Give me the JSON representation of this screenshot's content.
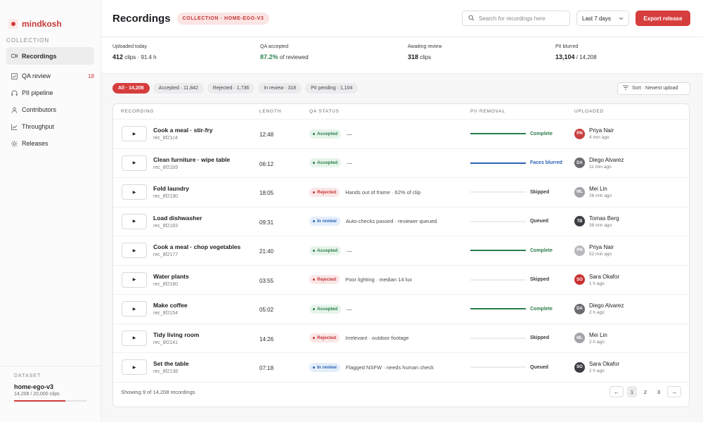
{
  "app": {
    "logo": "mindkosh"
  },
  "sidebar": {
    "section": "COLLECTION",
    "items": [
      {
        "label": "Recordings",
        "icon": "video-icon",
        "active": true,
        "badge": ""
      },
      {
        "label": "QA review",
        "icon": "checkbox-icon",
        "active": false,
        "badge": "18"
      },
      {
        "label": "PII pipeline",
        "icon": "headphones-icon",
        "active": false,
        "badge": ""
      },
      {
        "label": "Contributors",
        "icon": "person-icon",
        "active": false,
        "badge": ""
      },
      {
        "label": "Throughput",
        "icon": "chart-icon",
        "active": false,
        "badge": ""
      },
      {
        "label": "Releases",
        "icon": "sun-icon",
        "active": false,
        "badge": ""
      }
    ],
    "dataset": {
      "label": "DATASET",
      "name": "home-ego-v3",
      "count": "14,208 / 20,000 clips",
      "progress": 0.71,
      "color": "#d03b3b"
    }
  },
  "header": {
    "title": "Recordings",
    "collection": "COLLECTION · HOME-EGO-V3",
    "search_placeholder": "Search for recordings here",
    "range": "Last 7 days",
    "export": "Export release"
  },
  "stats": [
    {
      "label": "Uploaded today",
      "value": "412",
      "suffix": " clips · 91.4 h"
    },
    {
      "label": "QA accepted",
      "value": "87.2%",
      "suffix": " of reviewed"
    },
    {
      "label": "Awaiting review",
      "value": "318",
      "suffix": " clips"
    },
    {
      "label": "PII blurred",
      "value": "13,104",
      "suffix": " / 14,208"
    }
  ],
  "filters": [
    "All · 14,208",
    "Accepted · 11,842",
    "Rejected · 1,736",
    "In review · 318",
    "PII pending · 1,104"
  ],
  "sort": "Sort · Newest upload",
  "table": {
    "headers": [
      "RECORDING",
      "LENGTH",
      "QA STATUS",
      "PII REMOVAL",
      "UPLOADED"
    ],
    "rows": [
      {
        "title": "Cook a meal · stir-fry",
        "id": "rec_8f21c4",
        "length": "12:48",
        "qa": "Accepted",
        "qa_type": "acc",
        "note": "—",
        "pii": "Complete",
        "pii_progress": 1,
        "pii_color": "#2a7d4a",
        "initials": "PN",
        "avatar_color": "#c94040",
        "user": "Priya Nair",
        "time": "4 min ago"
      },
      {
        "title": "Clean furniture · wipe table",
        "id": "rec_8f21b9",
        "length": "06:12",
        "qa": "Accepted",
        "qa_type": "acc",
        "note": "—",
        "pii": "Faces blurred",
        "pii_progress": 1,
        "pii_color": "#2b64b5",
        "initials": "DA",
        "avatar_color": "#6b6b70",
        "user": "Diego Alvarez",
        "time": "11 min ago"
      },
      {
        "title": "Fold laundry",
        "id": "rec_8f2190",
        "length": "18:05",
        "qa": "Rejected",
        "qa_type": "rej",
        "note": "Hands out of frame · 62% of clip",
        "pii": "Skipped",
        "pii_progress": 0,
        "pii_color": "#3a3b40",
        "initials": "ML",
        "avatar_color": "#a3a3a8",
        "user": "Mei Lin",
        "time": "26 min ago"
      },
      {
        "title": "Load dishwasher",
        "id": "rec_8f2183",
        "length": "09:31",
        "qa": "In review",
        "qa_type": "rev",
        "note": "Auto-checks passed · reviewer queued",
        "pii": "Queued",
        "pii_progress": 0,
        "pii_color": "#3a3b40",
        "initials": "TB",
        "avatar_color": "#3c3d42",
        "user": "Tomas Berg",
        "time": "38 min ago"
      },
      {
        "title": "Cook a meal · chop vegetables",
        "id": "rec_8f2177",
        "length": "21:40",
        "qa": "Accepted",
        "qa_type": "acc",
        "note": "—",
        "pii": "Complete",
        "pii_progress": 1,
        "pii_color": "#2a7d4a",
        "initials": "PN",
        "avatar_color": "#b9b9bd",
        "user": "Priya Nair",
        "time": "52 min ago"
      },
      {
        "title": "Water plants",
        "id": "rec_8f2160",
        "length": "03:55",
        "qa": "Rejected",
        "qa_type": "rej",
        "note": "Poor lighting · median 14 lux",
        "pii": "Skipped",
        "pii_progress": 0,
        "pii_color": "#3a3b40",
        "initials": "SO",
        "avatar_color": "#c93232",
        "user": "Sara Okafor",
        "time": "1 h ago"
      },
      {
        "title": "Make coffee",
        "id": "rec_8f2154",
        "length": "05:02",
        "qa": "Accepted",
        "qa_type": "acc",
        "note": "—",
        "pii": "Complete",
        "pii_progress": 1,
        "pii_color": "#2a7d4a",
        "initials": "DA",
        "avatar_color": "#6b6b70",
        "user": "Diego Alvarez",
        "time": "2 h ago"
      },
      {
        "title": "Tidy living room",
        "id": "rec_8f2141",
        "length": "14:26",
        "qa": "Rejected",
        "qa_type": "rej",
        "note": "Irrelevant · outdoor footage",
        "pii": "Skipped",
        "pii_progress": 0,
        "pii_color": "#3a3b40",
        "initials": "ML",
        "avatar_color": "#a3a3a8",
        "user": "Mei Lin",
        "time": "2 h ago"
      },
      {
        "title": "Set the table",
        "id": "rec_8f2138",
        "length": "07:18",
        "qa": "In review",
        "qa_type": "rev",
        "note": "Flagged NSFW · needs human check",
        "pii": "Queued",
        "pii_progress": 0,
        "pii_color": "#3a3b40",
        "initials": "SO",
        "avatar_color": "#3c3d42",
        "user": "Sara Okafor",
        "time": "2 h ago"
      }
    ],
    "footer": "Showing 9 of 14,208 recordings",
    "pages": [
      "1",
      "2",
      "3"
    ],
    "prev": "←",
    "next": "→"
  }
}
